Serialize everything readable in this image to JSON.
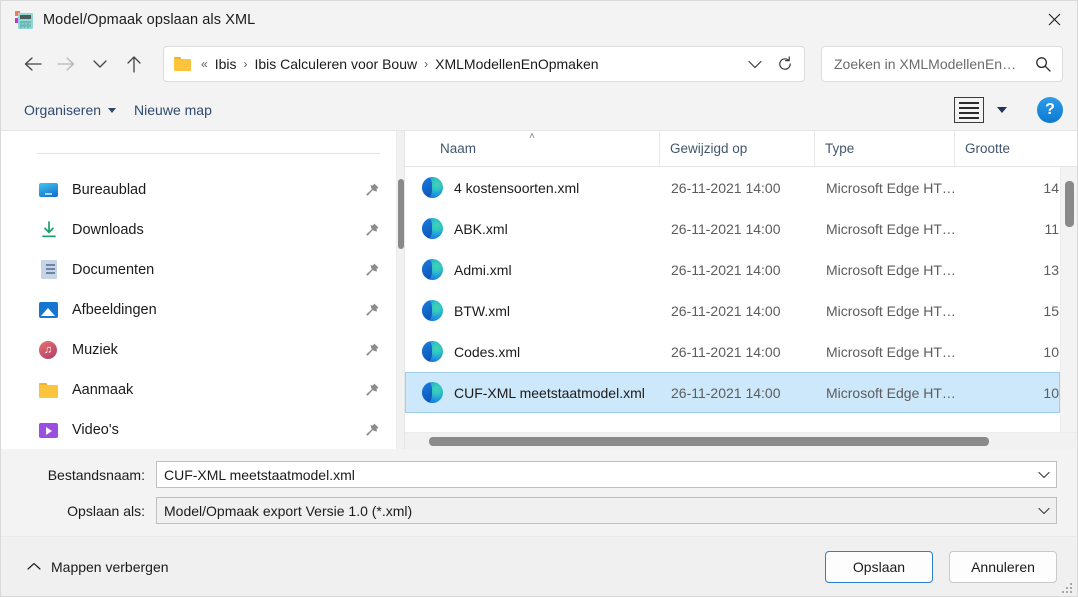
{
  "window": {
    "title": "Model/Opmaak opslaan als XML",
    "icon": "calculator-icon",
    "close_label": "✕"
  },
  "nav": {
    "back_icon": "arrow-left-icon",
    "forward_icon": "arrow-right-icon",
    "recent_icon": "chevron-down-icon",
    "up_icon": "arrow-up-icon"
  },
  "address": {
    "folder_icon": "folder-icon",
    "overflow": "«",
    "crumbs": [
      "Ibis",
      "Ibis Calculeren voor Bouw",
      "XMLModellenEnOpmaken"
    ],
    "separator": "›",
    "dropdown_icon": "chevron-down-icon",
    "refresh_icon": "refresh-icon"
  },
  "search": {
    "placeholder": "Zoeken in XMLModellenEn…",
    "value": "",
    "icon": "search-icon"
  },
  "commandbar": {
    "organise_label": "Organiseren",
    "new_folder_label": "Nieuwe map",
    "view_icon": "list-view-icon",
    "view_caret_icon": "chevron-down-icon",
    "help_label": "?"
  },
  "sidebar": {
    "items": [
      {
        "label": "Bureaublad",
        "icon": "desktop-icon",
        "pin": "pin-icon"
      },
      {
        "label": "Downloads",
        "icon": "download-icon",
        "pin": "pin-icon"
      },
      {
        "label": "Documenten",
        "icon": "documents-icon",
        "pin": "pin-icon"
      },
      {
        "label": "Afbeeldingen",
        "icon": "pictures-icon",
        "pin": "pin-icon"
      },
      {
        "label": "Muziek",
        "icon": "music-icon",
        "pin": "pin-icon"
      },
      {
        "label": "Aanmaak",
        "icon": "folder-icon",
        "pin": "pin-icon"
      },
      {
        "label": "Video's",
        "icon": "video-icon",
        "pin": "pin-icon"
      }
    ]
  },
  "filelist": {
    "columns": {
      "name": "Naam",
      "modified": "Gewijzigd op",
      "type": "Type",
      "size": "Grootte"
    },
    "sort_indicator": "˄",
    "rows": [
      {
        "name": "4 kostensoorten.xml",
        "modified": "26-11-2021 14:00",
        "type": "Microsoft Edge HT…",
        "size": "14",
        "icon": "edge-file-icon",
        "selected": false
      },
      {
        "name": "ABK.xml",
        "modified": "26-11-2021 14:00",
        "type": "Microsoft Edge HT…",
        "size": "11",
        "icon": "edge-file-icon",
        "selected": false
      },
      {
        "name": "Admi.xml",
        "modified": "26-11-2021 14:00",
        "type": "Microsoft Edge HT…",
        "size": "13",
        "icon": "edge-file-icon",
        "selected": false
      },
      {
        "name": "BTW.xml",
        "modified": "26-11-2021 14:00",
        "type": "Microsoft Edge HT…",
        "size": "15",
        "icon": "edge-file-icon",
        "selected": false
      },
      {
        "name": "Codes.xml",
        "modified": "26-11-2021 14:00",
        "type": "Microsoft Edge HT…",
        "size": "10",
        "icon": "edge-file-icon",
        "selected": false
      },
      {
        "name": "CUF-XML meetstaatmodel.xml",
        "modified": "26-11-2021 14:00",
        "type": "Microsoft Edge HT…",
        "size": "10",
        "icon": "edge-file-icon",
        "selected": true
      }
    ]
  },
  "form": {
    "filename_label": "Bestandsnaam:",
    "filename_value": "CUF-XML meetstaatmodel.xml",
    "filetype_label": "Opslaan als:",
    "filetype_value": "Model/Opmaak export Versie 1.0 (*.xml)",
    "dropdown_icon": "chevron-down-icon"
  },
  "footer": {
    "hide_folders_label": "Mappen verbergen",
    "hide_folders_icon": "chevron-up-icon",
    "save_label": "Opslaan",
    "cancel_label": "Annuleren",
    "resize_grip": "resize-grip-icon"
  },
  "colors": {
    "selection": "#cde8fa",
    "accent": "#2f7fd0",
    "command_text": "#2f4a6d",
    "header_text": "#41566f"
  }
}
